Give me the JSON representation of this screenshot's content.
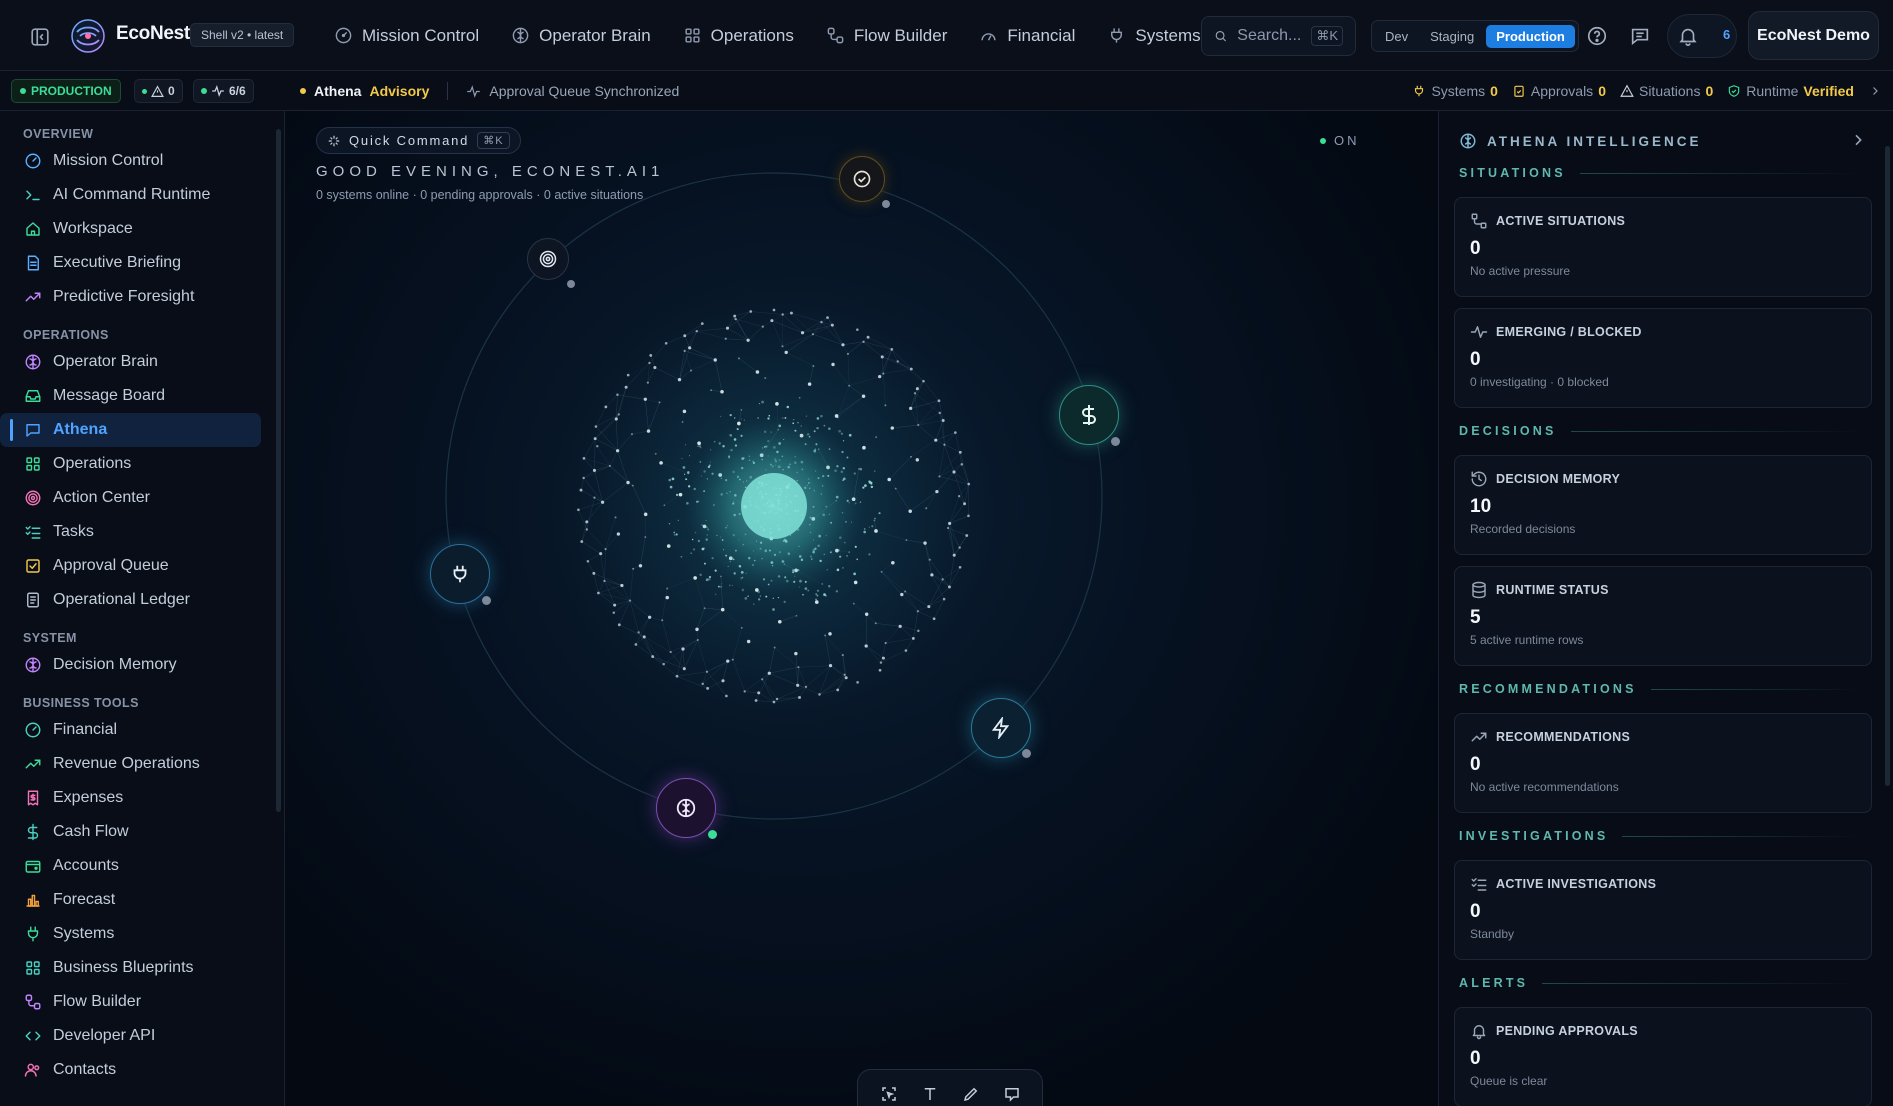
{
  "brand": {
    "name": "EcoNest",
    "shell_badge": "Shell v2 • latest"
  },
  "topnav": [
    {
      "label": "Mission Control",
      "icon": "gauge-icon"
    },
    {
      "label": "Operator Brain",
      "icon": "brain-icon"
    },
    {
      "label": "Operations",
      "icon": "grid-icon"
    },
    {
      "label": "Flow Builder",
      "icon": "workflow-icon"
    },
    {
      "label": "Financial",
      "icon": "gauge-icon"
    },
    {
      "label": "Systems",
      "icon": "plug-icon"
    }
  ],
  "search": {
    "placeholder": "Search...",
    "shortcut": "⌘K"
  },
  "environments": {
    "dev": "Dev",
    "staging": "Staging",
    "production": "Production",
    "active": "Production"
  },
  "notifications": {
    "count": "6"
  },
  "user": {
    "name": "EcoNest Demo"
  },
  "subbar": {
    "env_badge": "PRODUCTION",
    "alert_count": "0",
    "health": "6/6",
    "page": "Athena",
    "mode": "Advisory",
    "status": "Approval Queue Synchronized",
    "strip": [
      {
        "label": "Systems",
        "value": "0",
        "icon": "plug-icon"
      },
      {
        "label": "Approvals",
        "value": "0",
        "icon": "clipboard-check-icon"
      },
      {
        "label": "Situations",
        "value": "0",
        "icon": "warning-icon"
      },
      {
        "label": "Runtime",
        "value": "Verified",
        "icon": "shield-check-icon"
      }
    ]
  },
  "sidebar": {
    "sections": {
      "overview": "OVERVIEW",
      "operations": "OPERATIONS",
      "system": "SYSTEM",
      "business": "BUSINESS TOOLS"
    },
    "overview": [
      {
        "label": "Mission Control",
        "icon": "gauge-icon",
        "color": "#5ab0ff"
      },
      {
        "label": "AI Command Runtime",
        "icon": "terminal-icon",
        "color": "#4ad0c0"
      },
      {
        "label": "Workspace",
        "icon": "home-icon",
        "color": "#3ddc97"
      },
      {
        "label": "Executive Briefing",
        "icon": "document-icon",
        "color": "#5ab0ff"
      },
      {
        "label": "Predictive Foresight",
        "icon": "trend-up-icon",
        "color": "#c084fc"
      }
    ],
    "operations": [
      {
        "label": "Operator Brain",
        "icon": "brain-icon",
        "color": "#c084fc"
      },
      {
        "label": "Message Board",
        "icon": "inbox-icon",
        "color": "#3ddc97"
      },
      {
        "label": "Athena",
        "icon": "chat-icon",
        "color": "#4fa3ff",
        "active": true
      },
      {
        "label": "Operations",
        "icon": "grid-icon",
        "color": "#3ddc97"
      },
      {
        "label": "Action Center",
        "icon": "target-icon",
        "color": "#f472b6"
      },
      {
        "label": "Tasks",
        "icon": "list-check-icon",
        "color": "#4ad0c0"
      },
      {
        "label": "Approval Queue",
        "icon": "checkbox-icon",
        "color": "#f3c94a"
      },
      {
        "label": "Operational Ledger",
        "icon": "ledger-icon",
        "color": "#b0bccd"
      }
    ],
    "system": [
      {
        "label": "Decision Memory",
        "icon": "brain-icon",
        "color": "#c084fc"
      }
    ],
    "business": [
      {
        "label": "Financial",
        "icon": "gauge-icon",
        "color": "#4ad0c0"
      },
      {
        "label": "Revenue Operations",
        "icon": "trend-up-icon",
        "color": "#3ddc97"
      },
      {
        "label": "Expenses",
        "icon": "receipt-icon",
        "color": "#f472b6"
      },
      {
        "label": "Cash Flow",
        "icon": "dollar-icon",
        "color": "#4ad0c0"
      },
      {
        "label": "Accounts",
        "icon": "wallet-icon",
        "color": "#3ddc97"
      },
      {
        "label": "Forecast",
        "icon": "bar-chart-icon",
        "color": "#f3a13a"
      },
      {
        "label": "Systems",
        "icon": "plug-icon",
        "color": "#3ddc97"
      },
      {
        "label": "Business Blueprints",
        "icon": "grid-icon",
        "color": "#4ad0c0"
      },
      {
        "label": "Flow Builder",
        "icon": "workflow-icon",
        "color": "#c084fc"
      },
      {
        "label": "Developer API",
        "icon": "code-icon",
        "color": "#4ad0c0"
      },
      {
        "label": "Contacts",
        "icon": "users-icon",
        "color": "#f472b6"
      }
    ]
  },
  "main": {
    "quick_command": "Quick Command",
    "quick_command_kbd": "⌘K",
    "greeting": "GOOD EVENING, ECONEST.AI1",
    "summary": "0 systems online · 0 pending approvals · 0 active situations",
    "status_label": "ON"
  },
  "rpanel": {
    "title": "ATHENA INTELLIGENCE",
    "sections": [
      {
        "label": "SITUATIONS",
        "cards": [
          {
            "title": "ACTIVE SITUATIONS",
            "value": "0",
            "sub": "No active pressure",
            "icon": "branch-icon"
          },
          {
            "title": "EMERGING / BLOCKED",
            "value": "0",
            "sub": "0 investigating · 0 blocked",
            "icon": "pulse-icon"
          }
        ]
      },
      {
        "label": "DECISIONS",
        "cards": [
          {
            "title": "DECISION MEMORY",
            "value": "10",
            "sub": "Recorded decisions",
            "icon": "history-icon"
          },
          {
            "title": "RUNTIME STATUS",
            "value": "5",
            "sub": "5 active runtime rows",
            "icon": "database-icon"
          }
        ]
      },
      {
        "label": "RECOMMENDATIONS",
        "cards": [
          {
            "title": "RECOMMENDATIONS",
            "value": "0",
            "sub": "No active recommendations",
            "icon": "trend-up-icon"
          }
        ]
      },
      {
        "label": "INVESTIGATIONS",
        "cards": [
          {
            "title": "ACTIVE INVESTIGATIONS",
            "value": "0",
            "sub": "Standby",
            "icon": "list-check-icon"
          }
        ]
      },
      {
        "label": "ALERTS",
        "cards": [
          {
            "title": "PENDING APPROVALS",
            "value": "0",
            "sub": "Queue is clear",
            "icon": "bell-icon"
          }
        ]
      }
    ]
  },
  "colors": {
    "accent": "#4fa3ff",
    "success": "#3ddc97",
    "warning": "#f3c94a",
    "teal": "#4ad0c0"
  }
}
